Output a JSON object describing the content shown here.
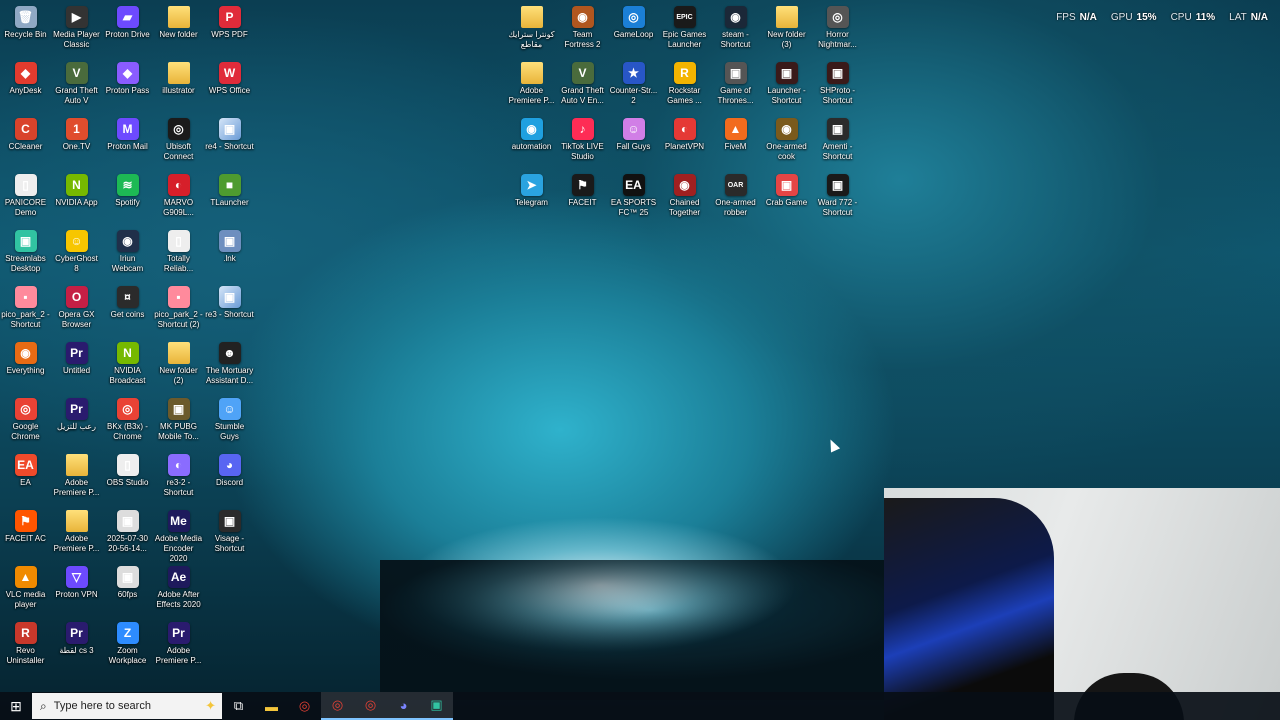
{
  "stats": {
    "fps_label": "FPS",
    "fps_value": "N/A",
    "gpu_label": "GPU",
    "gpu_value": "15%",
    "cpu_label": "CPU",
    "cpu_value": "11%",
    "lat_label": "LAT",
    "lat_value": "N/A"
  },
  "desktop": {
    "col1": [
      {
        "label": "Recycle Bin",
        "glyph": "🗑",
        "color": "#8fa8c4"
      },
      {
        "label": "AnyDesk",
        "glyph": "◆",
        "color": "#e23b2e"
      },
      {
        "label": "CCleaner",
        "glyph": "C",
        "color": "#d9432b"
      },
      {
        "label": "PANICORE Demo",
        "glyph": "▯",
        "color": "#eeeeee"
      },
      {
        "label": "Streamlabs Desktop",
        "glyph": "▣",
        "color": "#31c3a2"
      },
      {
        "label": "pico_park_2 - Shortcut",
        "glyph": "▪",
        "color": "#ff8a9c"
      },
      {
        "label": "Everything",
        "glyph": "◉",
        "color": "#e86b14"
      },
      {
        "label": "Google Chrome",
        "glyph": "◎",
        "color": "#e94235"
      },
      {
        "label": "EA",
        "glyph": "EA",
        "color": "#f04a2b"
      },
      {
        "label": "FACEIT AC",
        "glyph": "⚑",
        "color": "#ff5500"
      },
      {
        "label": "VLC media player",
        "glyph": "▲",
        "color": "#f08a00"
      },
      {
        "label": "Revo Uninstaller",
        "glyph": "R",
        "color": "#c8382b"
      }
    ],
    "col2": [
      {
        "label": "Media Player Classic",
        "glyph": "▶",
        "color": "#333333"
      },
      {
        "label": "Grand Theft Auto V",
        "glyph": "V",
        "color": "#4a6b3c"
      },
      {
        "label": "One.TV",
        "glyph": "1",
        "color": "#e04d2d"
      },
      {
        "label": "NVIDIA App",
        "glyph": "N",
        "color": "#76b900"
      },
      {
        "label": "CyberGhost 8",
        "glyph": "☺",
        "color": "#f7c600"
      },
      {
        "label": "Opera GX Browser",
        "glyph": "O",
        "color": "#c51f45"
      },
      {
        "label": "Untitled",
        "glyph": "Pr",
        "color": "#2a1b6e"
      },
      {
        "label": "رعب للتزيل",
        "glyph": "Pr",
        "color": "#2a1b6e"
      },
      {
        "label": "Adobe Premiere P...",
        "glyph": "",
        "color": "folder"
      },
      {
        "label": "Adobe Premiere P...",
        "glyph": "",
        "color": "folder"
      },
      {
        "label": "Proton VPN",
        "glyph": "▽",
        "color": "#6d4aff"
      },
      {
        "label": "لقطة cs 3",
        "glyph": "Pr",
        "color": "#2a1b6e"
      }
    ],
    "col3": [
      {
        "label": "Proton Drive",
        "glyph": "▰",
        "color": "#6d4aff"
      },
      {
        "label": "Proton Pass",
        "glyph": "◆",
        "color": "#8a5cff"
      },
      {
        "label": "Proton Mail",
        "glyph": "M",
        "color": "#6d4aff"
      },
      {
        "label": "Spotify",
        "glyph": "≋",
        "color": "#1db954"
      },
      {
        "label": "Iriun Webcam",
        "glyph": "◉",
        "color": "#20304a"
      },
      {
        "label": "Get coins",
        "glyph": "¤",
        "color": "#2b2b2b"
      },
      {
        "label": "NVIDIA Broadcast",
        "glyph": "N",
        "color": "#76b900"
      },
      {
        "label": "BKx (B3x) - Chrome",
        "glyph": "◎",
        "color": "#e94235"
      },
      {
        "label": "OBS Studio",
        "glyph": "▯",
        "color": "#eeeeee"
      },
      {
        "label": "2025-07-30 20-56-14...",
        "glyph": "▣",
        "color": "#dddddd"
      },
      {
        "label": "60fps",
        "glyph": "▣",
        "color": "#dddddd"
      },
      {
        "label": "Zoom Workplace",
        "glyph": "Z",
        "color": "#2d8cff"
      }
    ],
    "col4": [
      {
        "label": "New folder",
        "glyph": "",
        "color": "folder"
      },
      {
        "label": "illustrator",
        "glyph": "",
        "color": "folder"
      },
      {
        "label": "Ubisoft Connect",
        "glyph": "◎",
        "color": "#1b1b1b"
      },
      {
        "label": "MARVO G909L...",
        "glyph": "◐",
        "color": "#d61f2a"
      },
      {
        "label": "Totally Reliab...",
        "glyph": "▯",
        "color": "#eeeeee"
      },
      {
        "label": "pico_park_2 - Shortcut (2)",
        "glyph": "▪",
        "color": "#ff8a9c"
      },
      {
        "label": "New folder (2)",
        "glyph": "",
        "color": "folder"
      },
      {
        "label": "MK PUBG Mobile To...",
        "glyph": "▣",
        "color": "#6b5a2c"
      },
      {
        "label": "re3-2 - Shortcut",
        "glyph": "◐",
        "color": "#8a6cff"
      },
      {
        "label": "Adobe Media Encoder 2020",
        "glyph": "Me",
        "color": "#1e1a5c"
      },
      {
        "label": "Adobe After Effects 2020",
        "glyph": "Ae",
        "color": "#1e1a5c"
      },
      {
        "label": "Adobe Premiere P...",
        "glyph": "Pr",
        "color": "#2a1b6e"
      }
    ],
    "col5": [
      {
        "label": "WPS PDF",
        "glyph": "P",
        "color": "#e02b3a"
      },
      {
        "label": "WPS Office",
        "glyph": "W",
        "color": "#e02b3a"
      },
      {
        "label": "re4 - Shortcut",
        "glyph": "▣",
        "color": "shortcut"
      },
      {
        "label": "TLauncher",
        "glyph": "■",
        "color": "#4e9b2f"
      },
      {
        "label": ".lnk",
        "glyph": "▣",
        "color": "#6e8fbf"
      },
      {
        "label": "re3 - Shortcut",
        "glyph": "▣",
        "color": "shortcut"
      },
      {
        "label": "The Mortuary Assistant D...",
        "glyph": "☻",
        "color": "#222222"
      },
      {
        "label": "Stumble Guys",
        "glyph": "☺",
        "color": "#4fa3f7"
      },
      {
        "label": "Discord",
        "glyph": "◕",
        "color": "#5865f2"
      },
      {
        "label": "Visage - Shortcut",
        "glyph": "▣",
        "color": "#2b2b2b"
      }
    ],
    "top1": [
      {
        "label": "كونترا سترايك مقاطع",
        "glyph": "",
        "color": "folder"
      },
      {
        "label": "Adobe Premiere P...",
        "glyph": "",
        "color": "folder"
      },
      {
        "label": "automation",
        "glyph": "◉",
        "color": "#1fa0e0"
      },
      {
        "label": "Telegram",
        "glyph": "➤",
        "color": "#2aa3e0"
      }
    ],
    "top2": [
      {
        "label": "Team Fortress 2",
        "glyph": "◉",
        "color": "#b0561f"
      },
      {
        "label": "Grand Theft Auto V En...",
        "glyph": "V",
        "color": "#4a6b3c"
      },
      {
        "label": "TikTok LIVE Studio",
        "glyph": "♪",
        "color": "#fe2c55"
      },
      {
        "label": "FACEIT",
        "glyph": "⚑",
        "color": "#1a1a1a"
      }
    ],
    "top3": [
      {
        "label": "GameLoop",
        "glyph": "◎",
        "color": "#1b7fd6"
      },
      {
        "label": "Counter-Str... 2",
        "glyph": "★",
        "color": "#2856c7"
      },
      {
        "label": "Fall Guys",
        "glyph": "☺",
        "color": "#d17ee6"
      },
      {
        "label": "EA SPORTS FC™ 25",
        "glyph": "EA",
        "color": "#111111"
      }
    ],
    "top4": [
      {
        "label": "Epic Games Launcher",
        "glyph": "EPIC",
        "color": "#1a1a1a"
      },
      {
        "label": "Rockstar Games ...",
        "glyph": "R",
        "color": "#f4b400"
      },
      {
        "label": "PlanetVPN",
        "glyph": "◐",
        "color": "#e53935"
      },
      {
        "label": "Chained Together",
        "glyph": "◉",
        "color": "#a02020"
      }
    ],
    "top5": [
      {
        "label": "steam - Shortcut",
        "glyph": "◉",
        "color": "#1b2838"
      },
      {
        "label": "Game of Thrones...",
        "glyph": "▣",
        "color": "#555555"
      },
      {
        "label": "FiveM",
        "glyph": "▲",
        "color": "#f26b1d"
      },
      {
        "label": "One-armed robber",
        "glyph": "OAR",
        "color": "#2a2a2a"
      }
    ],
    "top6": [
      {
        "label": "New folder (3)",
        "glyph": "",
        "color": "folder"
      },
      {
        "label": "Launcher - Shortcut",
        "glyph": "▣",
        "color": "#3a1a1a"
      },
      {
        "label": "One-armed cook",
        "glyph": "◉",
        "color": "#7a5a1c"
      },
      {
        "label": "Crab Game",
        "glyph": "▣",
        "color": "#e44545"
      }
    ],
    "top7": [
      {
        "label": "Horror Nightmar...",
        "glyph": "◎",
        "color": "#555555"
      },
      {
        "label": "SHProto - Shortcut",
        "glyph": "▣",
        "color": "#3a1a1a"
      },
      {
        "label": "Amenti - Shortcut",
        "glyph": "▣",
        "color": "#2b2b2b"
      },
      {
        "label": "Ward 772 - Shortcut",
        "glyph": "▣",
        "color": "#1a1a1a"
      }
    ]
  },
  "taskbar": {
    "start_glyph": "⊞",
    "search_placeholder": "Type here to search",
    "search_glyph": "⌕",
    "spark_glyph": "✦",
    "buttons": [
      {
        "name": "task-view",
        "glyph": "⧉",
        "color": "#ffffff"
      },
      {
        "name": "file-explorer",
        "glyph": "▬",
        "color": "#f3c53b"
      },
      {
        "name": "chrome",
        "glyph": "◎",
        "color": "#e94235"
      },
      {
        "name": "chrome-2",
        "glyph": "◎",
        "color": "#e94235"
      },
      {
        "name": "chrome-3",
        "glyph": "◎",
        "color": "#e94235"
      },
      {
        "name": "discord",
        "glyph": "◕",
        "color": "#7b85ff"
      },
      {
        "name": "streamlabs",
        "glyph": "▣",
        "color": "#31c3a2"
      }
    ]
  }
}
